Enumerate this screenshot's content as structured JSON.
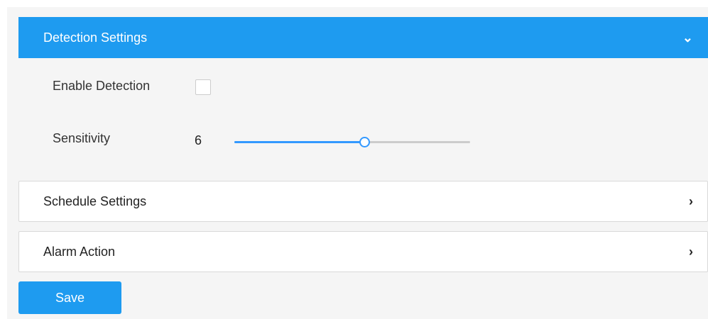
{
  "detection": {
    "header_label": "Detection Settings",
    "chevron_icon": "chevron-down-icon",
    "enable_label": "Enable Detection",
    "enable_checked": false,
    "sensitivity_label": "Sensitivity",
    "sensitivity_value": "6",
    "sensitivity_fraction": 0.55
  },
  "schedule": {
    "header_label": "Schedule Settings",
    "chevron_icon": "chevron-right-icon"
  },
  "alarm": {
    "header_label": "Alarm Action",
    "chevron_icon": "chevron-right-icon"
  },
  "actions": {
    "save_label": "Save"
  },
  "colors": {
    "accent": "#1e9bf0",
    "slider_fill": "#3399ff",
    "panel_background": "#f5f5f5"
  }
}
